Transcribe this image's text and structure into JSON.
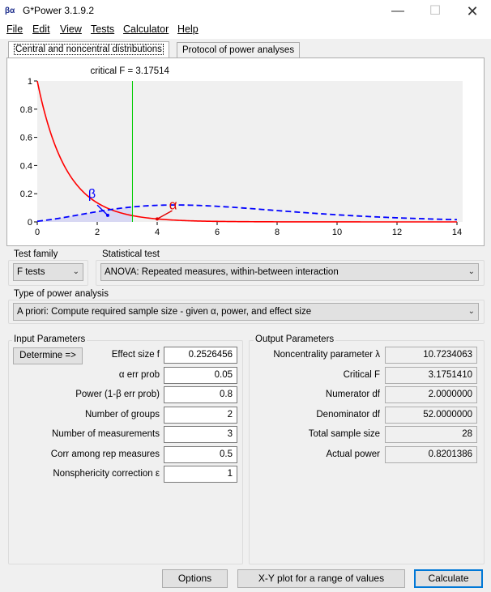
{
  "window": {
    "title": "G*Power 3.1.9.2",
    "icon": "gpower-app-icon",
    "icon_text": "βα"
  },
  "menu": [
    {
      "label": "File"
    },
    {
      "label": "Edit"
    },
    {
      "label": "View"
    },
    {
      "label": "Tests"
    },
    {
      "label": "Calculator"
    },
    {
      "label": "Help"
    }
  ],
  "tabs": [
    {
      "label": "Central and noncentral distributions",
      "active": true
    },
    {
      "label": "Protocol of power analyses",
      "active": false
    }
  ],
  "plot": {
    "critical_label": "critical F = 3.17514",
    "critical_value": 3.17514,
    "beta_symbol": "β",
    "alpha_symbol": "α",
    "y_ticks": [
      "1",
      "0.8",
      "0.6",
      "0.4",
      "0.2",
      "0"
    ],
    "x_ticks": [
      "0",
      "2",
      "4",
      "6",
      "8",
      "10",
      "12",
      "14"
    ],
    "x_range": [
      0,
      14
    ],
    "y_range": [
      0,
      1
    ],
    "central_color": "#ff0000",
    "noncentral_color": "#0000ff",
    "critical_color": "#00cc00"
  },
  "test_family": {
    "label": "Test family",
    "value": "F tests"
  },
  "statistical_test": {
    "label": "Statistical test",
    "value": "ANOVA: Repeated measures, within-between interaction"
  },
  "power_analysis": {
    "label": "Type of power analysis",
    "value": "A priori: Compute required sample size - given α, power, and effect size"
  },
  "input": {
    "label": "Input Parameters",
    "determine_label": "Determine =>",
    "params": [
      {
        "label": "Effect size f",
        "value": "0.2526456"
      },
      {
        "label": "α err prob",
        "value": "0.05"
      },
      {
        "label": "Power (1-β err prob)",
        "value": "0.8"
      },
      {
        "label": "Number of groups",
        "value": "2"
      },
      {
        "label": "Number of measurements",
        "value": "3"
      },
      {
        "label": "Corr among rep measures",
        "value": "0.5"
      },
      {
        "label": "Nonsphericity correction ε",
        "value": "1"
      }
    ]
  },
  "output": {
    "label": "Output Parameters",
    "params": [
      {
        "label": "Noncentrality parameter λ",
        "value": "10.7234063"
      },
      {
        "label": "Critical F",
        "value": "3.1751410"
      },
      {
        "label": "Numerator df",
        "value": "2.0000000"
      },
      {
        "label": "Denominator df",
        "value": "52.0000000"
      },
      {
        "label": "Total sample size",
        "value": "28"
      },
      {
        "label": "Actual power",
        "value": "0.8201386"
      }
    ]
  },
  "buttons": {
    "options": "Options",
    "xy_plot": "X-Y plot for a range of values",
    "calculate": "Calculate"
  }
}
